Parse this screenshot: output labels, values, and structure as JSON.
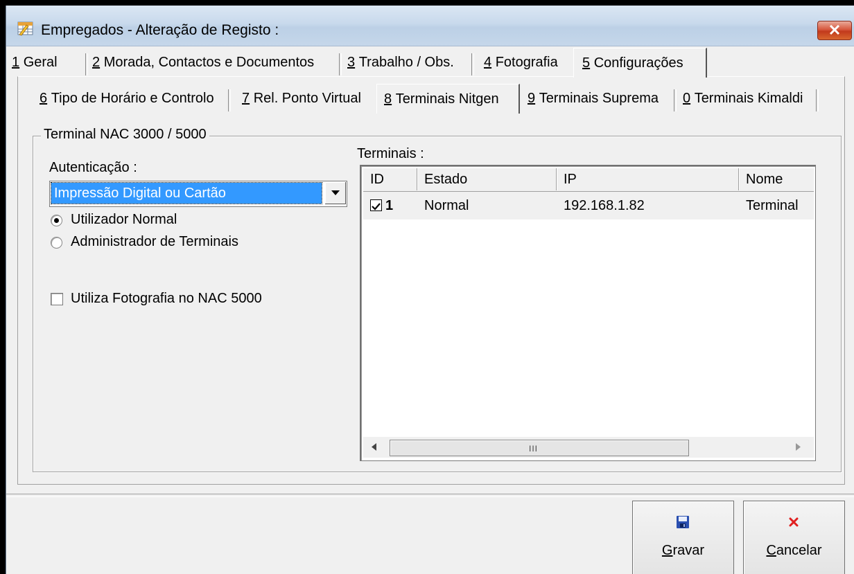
{
  "window": {
    "title": "Empregados - Alteração de Registo :"
  },
  "tabs_row1": [
    {
      "key": "1",
      "label": "Geral"
    },
    {
      "key": "2",
      "label": "Morada, Contactos e Documentos"
    },
    {
      "key": "3",
      "label": "Trabalho / Obs."
    },
    {
      "key": "4",
      "label": "Fotografia"
    },
    {
      "key": "5",
      "label": "Configurações",
      "selected": true
    }
  ],
  "tabs_row2": [
    {
      "key": "6",
      "label": "Tipo de Horário e Controlo"
    },
    {
      "key": "7",
      "label": "Rel. Ponto Virtual"
    },
    {
      "key": "8",
      "label": "Terminais Nitgen",
      "selected": true
    },
    {
      "key": "9",
      "label": "Terminais Suprema"
    },
    {
      "key": "0",
      "label": "Terminais Kimaldi"
    }
  ],
  "group": {
    "title": "Terminal NAC 3000 / 5000",
    "auth_label": "Autenticação :",
    "auth_value": "Impressão Digital ou Cartão",
    "radio_normal": "Utilizador Normal",
    "radio_admin": "Administrador de Terminais",
    "radio_selected": "normal",
    "photo_checkbox": "Utiliza Fotografia no NAC 5000",
    "photo_checked": false,
    "terminals_label": "Terminais :"
  },
  "terminals": {
    "columns": [
      "ID",
      "Estado",
      "IP",
      "Nome"
    ],
    "rows": [
      {
        "checked": true,
        "id": "1",
        "estado": "Normal",
        "ip": "192.168.1.82",
        "nome": "Terminal"
      }
    ],
    "scroll_grip": "III"
  },
  "buttons": {
    "save": {
      "mnemonic": "G",
      "rest": "ravar"
    },
    "cancel": {
      "mnemonic": "C",
      "rest": "ancelar"
    }
  },
  "colors": {
    "selection": "#3399ff",
    "close": "#c23a1c",
    "save_icon": "#2a4fb0",
    "cancel_icon": "#e02020"
  }
}
